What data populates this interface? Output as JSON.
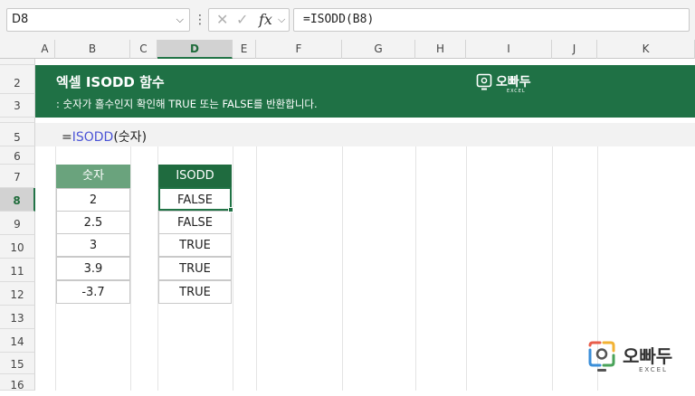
{
  "formula_bar": {
    "name_box": "D8",
    "fx_label": "fx",
    "formula": "=ISODD(B8)"
  },
  "columns": [
    "A",
    "B",
    "C",
    "D",
    "E",
    "F",
    "G",
    "H",
    "I",
    "J",
    "K"
  ],
  "selected_column": "D",
  "rows": [
    "2",
    "3",
    "5",
    "6",
    "7",
    "8",
    "9",
    "10",
    "11",
    "12",
    "13",
    "14",
    "15",
    "16"
  ],
  "selected_row": "8",
  "banner": {
    "title": "엑셀 ISODD 함수",
    "subtitle": ": 숫자가 홀수인지 확인해 TRUE 또는 FALSE를 반환합니다.",
    "logo_text": "오빠두",
    "logo_sub": "EXCEL",
    "color": "#1f7145"
  },
  "syntax": {
    "prefix": "=",
    "function": "ISODD",
    "args": "(숫자)"
  },
  "table_input": {
    "header": "숫자",
    "header_color": "#6aa37d",
    "values": [
      "2",
      "2.5",
      "3",
      "3.9",
      "-3.7"
    ]
  },
  "table_output": {
    "header": "ISODD",
    "header_color": "#1f6b3f",
    "values": [
      "FALSE",
      "FALSE",
      "TRUE",
      "TRUE",
      "TRUE"
    ]
  },
  "watermark": {
    "text": "오빠두",
    "sub": "EXCEL"
  }
}
